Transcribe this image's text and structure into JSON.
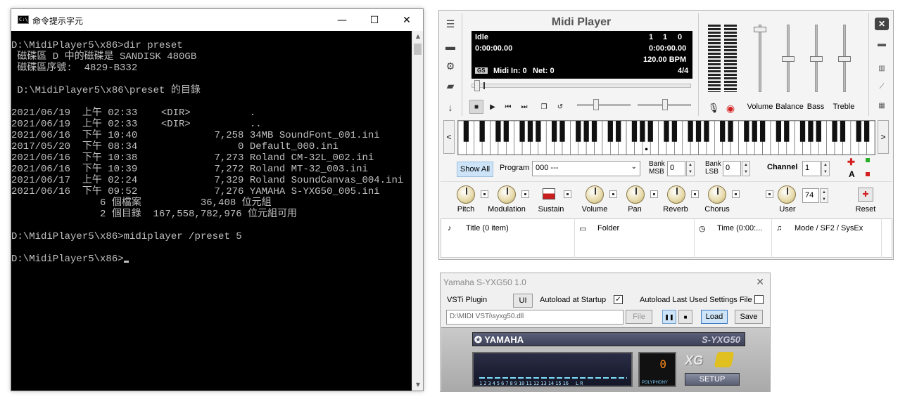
{
  "cmd": {
    "title": "命令提示字元",
    "icon": "cmd-icon",
    "icon_text": "C:\\",
    "lines": [
      "D:\\MidiPlayer5\\x86>dir preset",
      " 磁碟區 D 中的磁碟是 SANDISK 480GB",
      " 磁碟區序號:  4829-B332",
      "",
      " D:\\MidiPlayer5\\x86\\preset 的目錄",
      "",
      "2021/06/19  上午 02:33    <DIR>          .",
      "2021/06/19  上午 02:33    <DIR>          ..",
      "2021/06/16  下午 10:40             7,258 34MB SoundFont_001.ini",
      "2017/05/20  下午 08:34                 0 Default_000.ini",
      "2021/06/16  下午 10:38             7,273 Roland CM-32L_002.ini",
      "2021/06/16  下午 10:39             7,272 Roland MT-32_003.ini",
      "2021/06/17  上午 02:24             7,329 Roland SoundCanvas_004.ini",
      "2021/06/16  下午 09:52             7,276 YAMAHA S-YXG50_005.ini",
      "               6 個檔案          36,408 位元組",
      "               2 個目錄  167,558,782,976 位元組可用",
      "",
      "D:\\MidiPlayer5\\x86>midiplayer /preset 5",
      ""
    ],
    "prompt": "D:\\MidiPlayer5\\x86>"
  },
  "midi": {
    "title": "Midi Player",
    "status": "Idle",
    "position": "0:00:00.00",
    "duration": "0:00:00.00",
    "counter": [
      "1",
      "1",
      "0"
    ],
    "bpm": "120.00 BPM",
    "gs": "GS",
    "midi_in": "Midi In: 0",
    "net": "Net: 0",
    "time_sig": "4/4",
    "sliders": {
      "volume": "Volume",
      "balance": "Balance",
      "bass": "Bass",
      "treble": "Treble"
    },
    "show_all": "Show All",
    "program_label": "Program",
    "program_value": "000 ---",
    "bank_msb_label": "Bank MSB",
    "bank_msb_value": "0",
    "bank_lsb_label": "Bank LSB",
    "bank_lsb_value": "0",
    "channel_label": "Channel",
    "channel_value": "1",
    "knobs": {
      "pitch": "Pitch",
      "modulation": "Modulation",
      "sustain": "Sustain",
      "volume": "Volume",
      "pan": "Pan",
      "reverb": "Reverb",
      "chorus": "Chorus",
      "user": "User",
      "user_value": "74",
      "reset": "Reset"
    },
    "playlist_headers": {
      "title": "Title (0 item)",
      "folder": "Folder",
      "time": "Time (0:00:...",
      "mode": "Mode / SF2 / SysEx"
    },
    "right_btn_a": "A",
    "colors": {
      "red": "#d42020",
      "green": "#28b028"
    }
  },
  "vsti": {
    "title": "Yamaha S-YXG50 1.0",
    "plugin_label": "VSTi Plugin",
    "ui_button": "UI",
    "autoload_startup": "Autoload at Startup",
    "autoload_startup_checked": true,
    "autoload_last": "Autoload Last Used Settings File",
    "autoload_last_checked": false,
    "path": "D:\\MIDI VSTi\\syxg50.dll",
    "file_button": "File",
    "load_button": "Load",
    "save_button": "Save",
    "brand": "YAMAHA",
    "model": "S-YXG50",
    "xg_logo": "XG",
    "channels": [
      "1",
      "2",
      "3",
      "4",
      "5",
      "6",
      "7",
      "8",
      "9",
      "10",
      "11",
      "12",
      "13",
      "14",
      "15",
      "16",
      "L",
      "R"
    ],
    "polyphony_value": "0",
    "polyphony_label": "POLYPHONY",
    "setup_button": "SETUP"
  }
}
